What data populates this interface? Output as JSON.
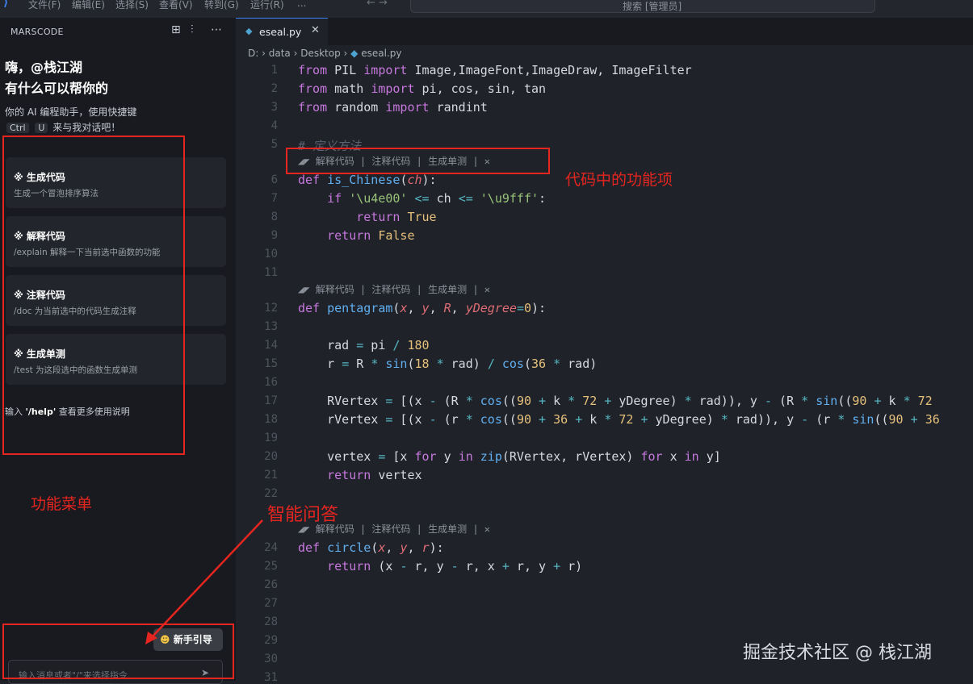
{
  "titlebar": {
    "menus": [
      "文件(F)",
      "编辑(E)",
      "选择(S)",
      "查看(V)",
      "转到(G)",
      "运行(R)",
      "..."
    ],
    "search": "搜索 [管理员]",
    "nav_arrows": "←  →"
  },
  "sidebar": {
    "title": "MARSCODE",
    "icons": [
      "plus-square-icon",
      "sliders-icon",
      "more-icon"
    ],
    "greeting_line1": "嗨，@栈江湖",
    "greeting_line2": "有什么可以帮你的",
    "desc_line1": "你的 AI 编程助手，使用快捷键",
    "key1": "Ctrl",
    "key2": "U",
    "desc_line2_suffix": "来与我对话吧！",
    "cards": [
      {
        "title": "生成代码",
        "desc": "生成一个冒泡排序算法"
      },
      {
        "title": "解释代码",
        "desc": "/explain 解释一下当前选中函数的功能"
      },
      {
        "title": "注释代码",
        "desc": "/doc 为当前选中的代码生成注释"
      },
      {
        "title": "生成单测",
        "desc": "/test 为这段选中的函数生成单测"
      }
    ],
    "help_prefix": "输入 ",
    "help_cmd": "'/help'",
    "help_suffix": " 查看更多使用说明",
    "guide_button": "新手引导",
    "chat_placeholder": "输入消息或者\"/\"来选择指令",
    "send_icon": "send-icon"
  },
  "annotations": {
    "menu_label": "功能菜单",
    "qa_label": "智能问答",
    "code_feature_label": "代码中的功能项"
  },
  "editor": {
    "tab_name": "eseal.py",
    "breadcrumb": [
      "D:",
      "data",
      "Desktop",
      "eseal.py"
    ],
    "lens": {
      "explain": "解释代码",
      "comment": "注释代码",
      "test": "生成单测"
    },
    "line_numbers": [
      "1",
      "2",
      "3",
      "4",
      "5",
      "",
      "6",
      "7",
      "8",
      "9",
      "10",
      "11",
      "",
      "12",
      "13",
      "14",
      "15",
      "16",
      "17",
      "18",
      "19",
      "20",
      "21",
      "22",
      "",
      "24",
      "25",
      "26",
      "27",
      "28",
      "29",
      "30",
      "31"
    ]
  },
  "colors": {
    "accent": "#3b82f6",
    "annotation_red": "#e5251f"
  },
  "watermark": "掘金技术社区 @ 栈江湖"
}
